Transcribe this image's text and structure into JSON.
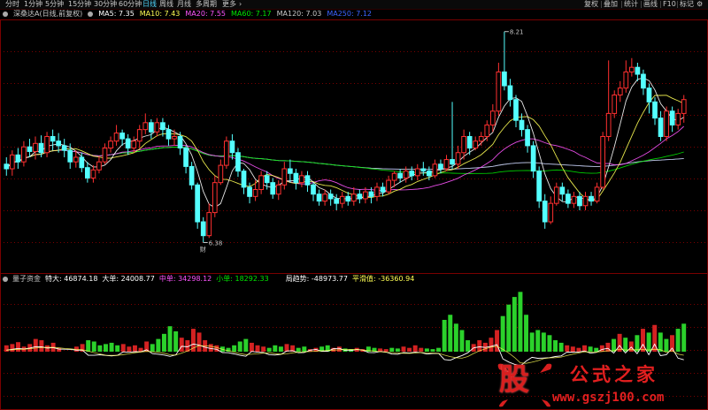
{
  "toolbar": {
    "tabs": [
      {
        "label": "分时",
        "active": false
      },
      {
        "label": "1分钟",
        "active": false
      },
      {
        "label": "5分钟",
        "active": false
      },
      {
        "label": "15分钟",
        "active": false
      },
      {
        "label": "30分钟",
        "active": false
      },
      {
        "label": "60分钟",
        "active": false
      },
      {
        "label": "日线",
        "active": true
      },
      {
        "label": "周线",
        "active": false
      },
      {
        "label": "月线",
        "active": false
      },
      {
        "label": "多周期",
        "active": false
      },
      {
        "label": "更多",
        "active": false
      }
    ],
    "right_buttons": [
      "复权",
      "叠加",
      "统计",
      "画线",
      "F10",
      "标记"
    ],
    "more_chevron": "›",
    "gear_icon": "gear-icon"
  },
  "price_info": {
    "title": "深桑达A(日线,前复权)",
    "ma5": "MA5: 7.35",
    "ma10": "MA10: 7.43",
    "ma20": "MA20: 7.55",
    "ma60": "MA60: 7.17",
    "ma120": "MA120: 7.03",
    "ma250": "MA250: 7.12"
  },
  "indicator_info": {
    "name": "量子资金",
    "special_large": "特大: 46874.18",
    "large": "大单: 24008.77",
    "medium": "中单: 34298.12",
    "small": "小单: 18292.33",
    "trend": "局趋势: -48973.77",
    "smooth": "平滑值: -36360.94"
  },
  "annotations": {
    "high_label": "8.21",
    "low_label": "6.38",
    "low_marker": "财"
  },
  "colors": {
    "up": "#ff3030",
    "down": "#54ffff",
    "ma5": "#ffffff",
    "ma10": "#ffff54",
    "ma20": "#ff54ff",
    "ma60": "#00e600",
    "ma120": "#c8c8c8",
    "ma250": "#3c64ff",
    "bar_pos": "#2bd12b",
    "bar_neg": "#d42222",
    "grid": "#7a0000"
  },
  "watermark": {
    "logo": "股",
    "name": "公式之家",
    "url": "www.gszj100.com"
  },
  "chart_data": {
    "type": "candlestick",
    "price_range": [
      6.2,
      8.3
    ],
    "candles": [
      [
        7.06,
        7.02,
        7.12,
        6.96
      ],
      [
        7.02,
        7.14,
        7.18,
        6.96
      ],
      [
        7.14,
        7.08,
        7.2,
        7.02
      ],
      [
        7.08,
        7.21,
        7.26,
        7.04
      ],
      [
        7.21,
        7.17,
        7.28,
        7.12
      ],
      [
        7.17,
        7.24,
        7.3,
        7.1
      ],
      [
        7.24,
        7.16,
        7.31,
        7.12
      ],
      [
        7.16,
        7.3,
        7.34,
        7.12
      ],
      [
        7.3,
        7.26,
        7.36,
        7.18
      ],
      [
        7.26,
        7.22,
        7.33,
        7.16
      ],
      [
        7.22,
        7.18,
        7.28,
        7.12
      ],
      [
        7.18,
        7.08,
        7.24,
        7.02
      ],
      [
        7.08,
        7.12,
        7.18,
        7.03
      ],
      [
        7.12,
        7.03,
        7.16,
        6.99
      ],
      [
        7.03,
        6.94,
        7.08,
        6.9
      ],
      [
        6.94,
        7.01,
        7.05,
        6.9
      ],
      [
        7.01,
        7.08,
        7.13,
        6.98
      ],
      [
        7.08,
        7.2,
        7.24,
        7.06
      ],
      [
        7.2,
        7.26,
        7.3,
        7.16
      ],
      [
        7.26,
        7.33,
        7.4,
        7.22
      ],
      [
        7.33,
        7.28,
        7.36,
        7.22
      ],
      [
        7.28,
        7.2,
        7.32,
        7.14
      ],
      [
        7.2,
        7.26,
        7.3,
        7.16
      ],
      [
        7.26,
        7.36,
        7.4,
        7.2
      ],
      [
        7.36,
        7.42,
        7.5,
        7.32
      ],
      [
        7.42,
        7.34,
        7.45,
        7.28
      ],
      [
        7.34,
        7.42,
        7.46,
        7.3
      ],
      [
        7.42,
        7.36,
        7.46,
        7.3
      ],
      [
        7.36,
        7.28,
        7.4,
        7.22
      ],
      [
        7.28,
        7.3,
        7.36,
        7.22
      ],
      [
        7.3,
        7.2,
        7.34,
        7.14
      ],
      [
        7.2,
        7.04,
        7.22,
        6.98
      ],
      [
        7.04,
        6.88,
        7.08,
        6.84
      ],
      [
        6.88,
        6.56,
        6.9,
        6.5
      ],
      [
        6.56,
        6.44,
        6.6,
        6.38
      ],
      [
        6.44,
        6.64,
        6.72,
        6.42
      ],
      [
        6.64,
        6.9,
        6.96,
        6.6
      ],
      [
        6.9,
        7.05,
        7.1,
        6.88
      ],
      [
        7.05,
        7.26,
        7.3,
        7.02
      ],
      [
        7.26,
        7.16,
        7.32,
        7.1
      ],
      [
        7.16,
        7.0,
        7.2,
        6.95
      ],
      [
        7.0,
        6.86,
        7.02,
        6.8
      ],
      [
        6.86,
        6.78,
        6.9,
        6.72
      ],
      [
        6.78,
        6.84,
        6.92,
        6.74
      ],
      [
        6.84,
        6.96,
        7.0,
        6.8
      ],
      [
        6.96,
        6.9,
        7.0,
        6.84
      ],
      [
        6.9,
        6.8,
        6.94,
        6.76
      ],
      [
        6.8,
        6.88,
        6.92,
        6.75
      ],
      [
        6.88,
        7.02,
        7.08,
        6.84
      ],
      [
        7.02,
        6.98,
        7.1,
        6.9
      ],
      [
        6.98,
        6.9,
        7.02,
        6.84
      ],
      [
        6.9,
        6.96,
        7.0,
        6.86
      ],
      [
        6.96,
        6.88,
        7.0,
        6.82
      ],
      [
        6.88,
        6.8,
        6.9,
        6.74
      ],
      [
        6.8,
        6.74,
        6.84,
        6.7
      ],
      [
        6.74,
        6.8,
        6.84,
        6.7
      ],
      [
        6.8,
        6.76,
        6.84,
        6.7
      ],
      [
        6.76,
        6.72,
        6.8,
        6.66
      ],
      [
        6.72,
        6.78,
        6.82,
        6.68
      ],
      [
        6.78,
        6.74,
        6.82,
        6.7
      ],
      [
        6.74,
        6.8,
        6.86,
        6.7
      ],
      [
        6.8,
        6.76,
        6.84,
        6.72
      ],
      [
        6.76,
        6.82,
        6.86,
        6.72
      ],
      [
        6.82,
        6.78,
        6.86,
        6.72
      ],
      [
        6.78,
        6.86,
        6.9,
        6.74
      ],
      [
        6.86,
        6.82,
        6.9,
        6.78
      ],
      [
        6.82,
        6.92,
        6.96,
        6.8
      ],
      [
        6.92,
        6.98,
        7.0,
        6.86
      ],
      [
        6.98,
        6.94,
        7.02,
        6.9
      ],
      [
        6.94,
        7.0,
        7.04,
        6.9
      ],
      [
        7.0,
        6.96,
        7.04,
        6.92
      ],
      [
        6.96,
        7.02,
        7.06,
        6.92
      ],
      [
        7.02,
        7.0,
        7.08,
        6.96
      ],
      [
        7.0,
        6.96,
        7.04,
        6.92
      ],
      [
        6.96,
        7.06,
        7.1,
        6.94
      ],
      [
        7.06,
        7.02,
        7.1,
        6.98
      ],
      [
        7.02,
        7.1,
        7.14,
        7.0
      ],
      [
        7.1,
        7.06,
        7.6,
        7.02
      ],
      [
        7.06,
        7.16,
        7.22,
        7.02
      ],
      [
        7.16,
        7.3,
        7.36,
        7.1
      ],
      [
        7.3,
        7.2,
        7.34,
        7.14
      ],
      [
        7.2,
        7.26,
        7.3,
        7.18
      ],
      [
        7.26,
        7.3,
        7.34,
        7.22
      ],
      [
        7.3,
        7.4,
        7.44,
        7.26
      ],
      [
        7.4,
        7.52,
        7.58,
        7.34
      ],
      [
        7.52,
        7.86,
        7.94,
        7.48
      ],
      [
        7.86,
        7.74,
        8.21,
        7.7
      ],
      [
        7.74,
        7.62,
        7.8,
        7.56
      ],
      [
        7.62,
        7.44,
        7.66,
        7.38
      ],
      [
        7.44,
        7.36,
        7.5,
        7.3
      ],
      [
        7.36,
        7.22,
        7.4,
        7.16
      ],
      [
        7.22,
        7.0,
        7.26,
        6.94
      ],
      [
        7.0,
        6.74,
        7.04,
        6.68
      ],
      [
        6.74,
        6.56,
        6.8,
        6.5
      ],
      [
        6.56,
        6.72,
        6.78,
        6.54
      ],
      [
        6.72,
        6.86,
        6.9,
        6.7
      ],
      [
        6.86,
        6.8,
        6.9,
        6.74
      ],
      [
        6.8,
        6.72,
        6.84,
        6.68
      ],
      [
        6.72,
        6.78,
        6.82,
        6.68
      ],
      [
        6.78,
        6.7,
        6.82,
        6.66
      ],
      [
        6.7,
        6.78,
        6.82,
        6.66
      ],
      [
        6.78,
        6.74,
        6.82,
        6.7
      ],
      [
        6.74,
        6.86,
        6.9,
        6.72
      ],
      [
        6.86,
        7.3,
        7.34,
        6.84
      ],
      [
        7.3,
        7.5,
        7.96,
        7.26
      ],
      [
        7.5,
        7.66,
        7.7,
        7.46
      ],
      [
        7.66,
        7.72,
        7.78,
        7.6
      ],
      [
        7.72,
        7.86,
        7.96,
        7.68
      ],
      [
        7.86,
        7.9,
        7.98,
        7.82
      ],
      [
        7.9,
        7.84,
        7.94,
        7.78
      ],
      [
        7.84,
        7.72,
        7.88,
        7.66
      ],
      [
        7.72,
        7.6,
        7.76,
        7.5
      ],
      [
        7.6,
        7.46,
        7.64,
        7.4
      ],
      [
        7.46,
        7.3,
        7.52,
        7.26
      ],
      [
        7.3,
        7.52,
        7.56,
        7.26
      ],
      [
        7.52,
        7.4,
        7.56,
        7.34
      ],
      [
        7.4,
        7.5,
        7.54,
        7.36
      ],
      [
        7.5,
        7.62,
        7.66,
        7.42
      ]
    ],
    "indicator_range": [
      -1.0,
      1.0
    ],
    "indicator_bars": [
      0.1,
      0.12,
      0.15,
      0.08,
      0.12,
      0.2,
      0.18,
      0.1,
      0.14,
      0.06,
      -0.08,
      -0.1,
      0.08,
      0.12,
      0.18,
      0.16,
      0.1,
      0.12,
      0.14,
      0.1,
      0.12,
      0.08,
      0.1,
      0.06,
      0.16,
      0.12,
      0.2,
      0.28,
      0.4,
      0.32,
      0.22,
      0.18,
      0.36,
      0.3,
      0.18,
      0.12,
      0.1,
      0.08,
      0.06,
      0.1,
      0.16,
      0.2,
      0.14,
      0.1,
      0.08,
      0.06,
      0.1,
      0.08,
      0.12,
      0.1,
      0.06,
      0.08,
      0.04,
      0.06,
      0.08,
      0.1,
      0.06,
      0.08,
      0.05,
      0.04,
      0.06,
      0.04,
      0.08,
      0.06,
      0.05,
      0.04,
      0.06,
      0.05,
      0.08,
      0.06,
      0.1,
      0.06,
      0.05,
      0.04,
      0.06,
      0.5,
      0.58,
      0.44,
      0.34,
      0.18,
      0.12,
      0.18,
      0.14,
      0.22,
      0.34,
      0.56,
      0.74,
      0.86,
      0.94,
      0.58,
      0.3,
      0.34,
      0.3,
      0.26,
      0.18,
      0.14,
      0.1,
      0.08,
      0.06,
      0.1,
      0.08,
      0.06,
      0.1,
      0.14,
      0.2,
      0.28,
      0.22,
      0.16,
      0.26,
      0.36,
      0.3,
      0.42,
      0.3,
      0.2,
      0.26,
      0.36,
      0.44
    ],
    "indicator_bar_signs": [
      -1,
      -1,
      -1,
      -1,
      -1,
      -1,
      -1,
      -1,
      -1,
      -1,
      1,
      1,
      -1,
      -1,
      1,
      1,
      1,
      1,
      1,
      1,
      -1,
      -1,
      -1,
      -1,
      -1,
      1,
      1,
      1,
      1,
      1,
      -1,
      -1,
      -1,
      -1,
      -1,
      -1,
      -1,
      1,
      1,
      1,
      1,
      1,
      -1,
      -1,
      -1,
      1,
      1,
      1,
      -1,
      -1,
      1,
      1,
      -1,
      -1,
      1,
      1,
      -1,
      -1,
      1,
      1,
      -1,
      -1,
      1,
      1,
      -1,
      -1,
      1,
      1,
      -1,
      -1,
      -1,
      -1,
      1,
      1,
      1,
      1,
      1,
      1,
      1,
      1,
      -1,
      -1,
      -1,
      -1,
      -1,
      1,
      1,
      1,
      1,
      1,
      1,
      1,
      1,
      1,
      1,
      1,
      -1,
      -1,
      -1,
      -1,
      1,
      1,
      -1,
      -1,
      1,
      -1,
      1,
      -1,
      1,
      -1,
      1,
      -1,
      1,
      1,
      -1,
      1,
      1
    ]
  }
}
